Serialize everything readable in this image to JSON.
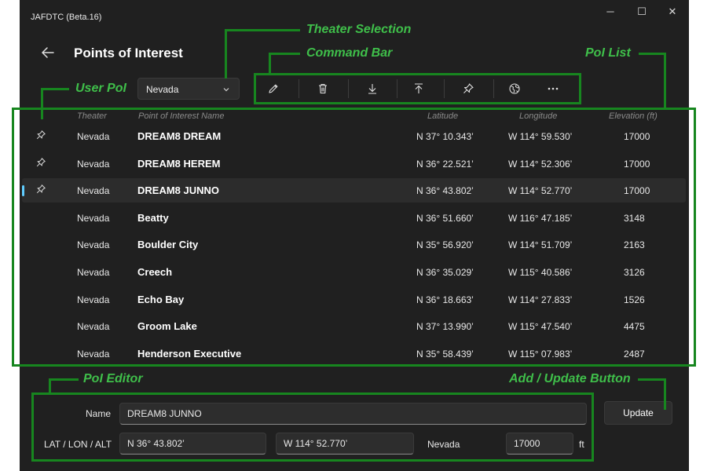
{
  "window": {
    "title": "JAFDTC (Beta.16)",
    "controls": {
      "minimize": "─",
      "maximize": "☐",
      "close": "✕"
    }
  },
  "header": {
    "title": "Points of Interest",
    "back_icon": "arrow-left-icon"
  },
  "theater_select": {
    "value": "Nevada",
    "icon": "chevron-down-icon"
  },
  "command_bar": {
    "buttons": [
      {
        "name": "edit",
        "icon": "pencil-icon"
      },
      {
        "name": "delete",
        "icon": "trash-icon"
      },
      {
        "name": "import",
        "icon": "download-icon"
      },
      {
        "name": "export",
        "icon": "upload-icon"
      },
      {
        "name": "pin",
        "icon": "pin-icon"
      },
      {
        "name": "coordinates",
        "icon": "globe-icon"
      },
      {
        "name": "more",
        "icon": "ellipsis-icon"
      }
    ]
  },
  "list": {
    "columns": {
      "theater": "Theater",
      "name": "Point of Interest Name",
      "latitude": "Latitude",
      "longitude": "Longitude",
      "elevation": "Elevation (ft)"
    },
    "rows": [
      {
        "pinned": true,
        "theater": "Nevada",
        "name": "DREAM8 DREAM",
        "lat": "N 37° 10.343’",
        "lon": "W 114° 59.530’",
        "elev": "17000"
      },
      {
        "pinned": true,
        "theater": "Nevada",
        "name": "DREAM8 HEREM",
        "lat": "N 36° 22.521’",
        "lon": "W 114° 52.306’",
        "elev": "17000"
      },
      {
        "pinned": true,
        "theater": "Nevada",
        "name": "DREAM8 JUNNO",
        "lat": "N 36° 43.802’",
        "lon": "W 114° 52.770’",
        "elev": "17000",
        "selected": true
      },
      {
        "pinned": false,
        "theater": "Nevada",
        "name": "Beatty",
        "lat": "N 36° 51.660’",
        "lon": "W 116° 47.185’",
        "elev": "3148"
      },
      {
        "pinned": false,
        "theater": "Nevada",
        "name": "Boulder City",
        "lat": "N 35° 56.920’",
        "lon": "W 114° 51.709’",
        "elev": "2163"
      },
      {
        "pinned": false,
        "theater": "Nevada",
        "name": "Creech",
        "lat": "N 36° 35.029’",
        "lon": "W 115° 40.586’",
        "elev": "3126"
      },
      {
        "pinned": false,
        "theater": "Nevada",
        "name": "Echo Bay",
        "lat": "N 36° 18.663’",
        "lon": "W 114° 27.833’",
        "elev": "1526"
      },
      {
        "pinned": false,
        "theater": "Nevada",
        "name": "Groom Lake",
        "lat": "N 37° 13.990’",
        "lon": "W 115° 47.540’",
        "elev": "4475"
      },
      {
        "pinned": false,
        "theater": "Nevada",
        "name": "Henderson Executive",
        "lat": "N 35° 58.439’",
        "lon": "W 115° 07.983’",
        "elev": "2487"
      }
    ]
  },
  "editor": {
    "name_label": "Name",
    "name_value": "DREAM8 JUNNO",
    "coord_label": "LAT / LON / ALT",
    "lat_value": "N 36° 43.802’",
    "lon_value": "W 114° 52.770’",
    "theater_value": "Nevada",
    "alt_value": "17000",
    "alt_unit": "ft"
  },
  "update_button": {
    "label": "Update"
  },
  "annotations": {
    "theater_selection": "Theater Selection",
    "command_bar": "Command Bar",
    "user_poi": "User PoI",
    "poi_list": "PoI List",
    "poi_editor": "PoI Editor",
    "add_update_button": "Add / Update Button"
  },
  "colors": {
    "background": "#202020",
    "selection_accent": "#60cdff",
    "annotation_green": "#17861f",
    "annotation_text": "#3fbf4a"
  }
}
